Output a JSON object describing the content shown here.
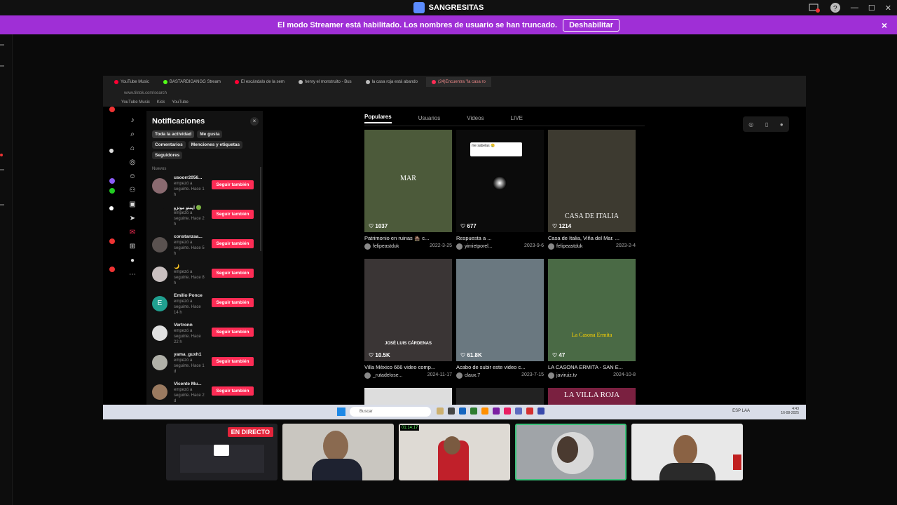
{
  "app": {
    "title": "SANGRESITAS"
  },
  "banner": {
    "message": "El modo Streamer está habilitado. Los nombres de usuario se han truncado.",
    "button": "Deshabilitar",
    "close": "×"
  },
  "browser": {
    "tabs": [
      {
        "label": "YouTube Music",
        "color": "#ff0033"
      },
      {
        "label": "BASTARDIGANGG Stream",
        "color": "#53fc18"
      },
      {
        "label": "El escándalo de la sem",
        "color": "#ff0033"
      },
      {
        "label": "henry el monstruito - Bus",
        "color": "#bbbbbb"
      },
      {
        "label": "la casa roja está abando",
        "color": "#bbbbbb"
      },
      {
        "label": "(24)Encuentra \"la casa ro",
        "color": "#fe2c55",
        "active": true
      }
    ],
    "url": "www.tiktok.com/search",
    "bookmarks": [
      "YouTube Music",
      "Kick",
      "YouTube"
    ]
  },
  "notifications": {
    "title": "Notificaciones",
    "close": "×",
    "chips": [
      "Toda la actividad",
      "Me gusta",
      "Comentarios",
      "Menciones y etiquetas",
      "Seguidores"
    ],
    "section": "Nuevos",
    "follow_label": "Seguir también",
    "items": [
      {
        "name": "usoorr2056...",
        "desc": "empezó a seguirte. Hace 1 h",
        "color": "#8a6a70"
      },
      {
        "name": "ايمنو مونزو 🟢",
        "desc": "empezó a seguirte. Hace 2 h",
        "color": "#121212"
      },
      {
        "name": "constanzaa...",
        "desc": "empezó a seguirte. Hace 5 h",
        "color": "#5a5250"
      },
      {
        "name": "🌙",
        "desc": "empezó a seguirte. Hace 8 h",
        "color": "#c9c0c0"
      },
      {
        "name": "Emilio Ponce",
        "desc": "empezó a seguirte. Hace 14 h",
        "color": "#20a090",
        "initial": "E"
      },
      {
        "name": "Vertronn",
        "desc": "empezó a seguirte. Hace 22 h",
        "color": "#e0e0e0"
      },
      {
        "name": "yama_guxh1",
        "desc": "empezó a seguirte. Hace 1 d",
        "color": "#b0b0a8"
      },
      {
        "name": "Vicente Mu...",
        "desc": "empezó a seguirte. Hace 2 d",
        "color": "#9a7a60"
      }
    ]
  },
  "search_tabs": [
    "Populares",
    "Usuarios",
    "Videos",
    "LIVE"
  ],
  "videos": [
    {
      "likes": "1037",
      "title": "Patrimonio en ruinas 🏚️ c...",
      "user": "felipeastduk",
      "date": "2022-3-25",
      "bg": "#4c5a3a",
      "overlay": "MAR"
    },
    {
      "likes": "677",
      "title": "Respuesta a ...",
      "user": "yimietporel...",
      "date": "2023-9-6",
      "bg": "#0b0b0b",
      "overlay": "",
      "caption": "me sabelas 😢"
    },
    {
      "likes": "1214",
      "title": "Casa de Italia, Viña del Mar. ...",
      "user": "felipeastduk",
      "date": "2023-2-4",
      "bg": "#3d3a30",
      "overlay": "CASA DE ITALIA"
    },
    {
      "likes": "10.5K",
      "title": "Villa México 666 video comp...",
      "user": "_rutadelose...",
      "date": "2024-11-17",
      "bg": "#3a3535",
      "overlay": "JOSÉ LUIS CÁRDENAS"
    },
    {
      "likes": "61.8K",
      "title": "Acabo de subir este video c...",
      "user": "claux.7",
      "date": "2023-7-15",
      "bg": "#6a7880",
      "overlay": ""
    },
    {
      "likes": "47",
      "title": "LA CASONA ERMITA - SAN E...",
      "user": "javiruiz.tv",
      "date": "2024-10-8",
      "bg": "#4a6a45",
      "overlay": "La Casona Ermita"
    }
  ],
  "partial_row_overlay": "LA VILLA ROJA",
  "taskbar": {
    "search": "Buscar",
    "lang": "ESP LAA",
    "time": "4:43",
    "date": "16-08-2025"
  },
  "cams": {
    "live_label": "EN DIRECTO",
    "timer": "01:14:17"
  }
}
